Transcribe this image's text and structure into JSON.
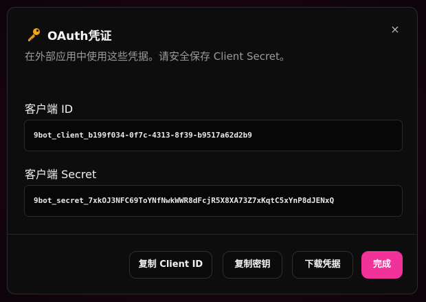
{
  "dialog": {
    "title": "OAuth凭证",
    "subtitle": "在外部应用中使用这些凭据。请安全保存 Client Secret。",
    "close_label": "×",
    "icons": {
      "title_icon": "key-icon",
      "close_icon": "close-icon"
    }
  },
  "fields": {
    "client_id": {
      "label": "客户端 ID",
      "value": "9bot_client_b199f034-0f7c-4313-8f39-b9517a62d2b9"
    },
    "client_secret": {
      "label": "客户端 Secret",
      "value": "9bot_secret_7xkOJ3NFC69ToYNfNwkWWR8dFcjR5X8XA73Z7xKqtC5xYnP8dJENxQ"
    }
  },
  "actions": {
    "copy_client_id": "复制 Client ID",
    "copy_secret": "复制密钥",
    "download": "下载凭据",
    "done": "完成"
  },
  "colors": {
    "accent": "#f0329a",
    "dialog_bg": "#0d0d0e",
    "key_icon": "#f2a516"
  }
}
